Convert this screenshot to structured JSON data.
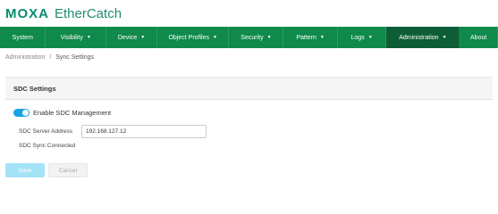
{
  "brand": {
    "logo": "MOXA",
    "product": "EtherCatch"
  },
  "nav": {
    "items": [
      {
        "label": "System",
        "dropdown": false
      },
      {
        "label": "Visibility",
        "dropdown": true
      },
      {
        "label": "Device",
        "dropdown": true
      },
      {
        "label": "Object Profiles",
        "dropdown": true
      },
      {
        "label": "Security",
        "dropdown": true
      },
      {
        "label": "Pattern",
        "dropdown": true
      },
      {
        "label": "Logs",
        "dropdown": true
      },
      {
        "label": "Administration",
        "dropdown": true,
        "active": true
      },
      {
        "label": "About",
        "dropdown": false
      }
    ]
  },
  "breadcrumb": {
    "parent": "Administration",
    "separator": "/",
    "current": "Sync Settings"
  },
  "card": {
    "title": "SDC Settings",
    "toggle": {
      "label": "Enable SDC Management",
      "enabled": true
    },
    "server_field": {
      "label": "SDC Server Address",
      "value": "192.168.127.12"
    },
    "status": "SDC Sync Connected"
  },
  "buttons": {
    "save": "Save",
    "cancel": "Cancel"
  },
  "colors": {
    "nav_bg": "#0f8a4b",
    "nav_active": "#0d5e37",
    "brand": "#0a8c6f",
    "toggle_on": "#1aa3e6",
    "save_button": "#a4e3f7"
  }
}
